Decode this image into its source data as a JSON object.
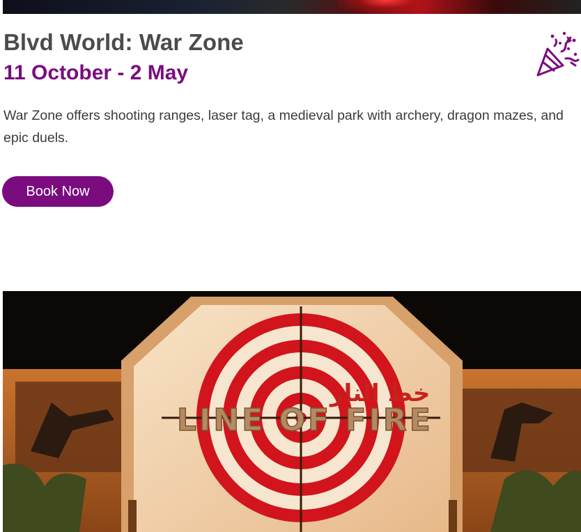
{
  "event": {
    "title": "Blvd World: War Zone",
    "dates": "11 October - 2 May",
    "description": "War Zone offers shooting ranges, laser tag, a medieval park with archery, dragon mazes, and epic duels.",
    "book_label": "Book Now"
  },
  "photo": {
    "sign_text": "LINE OF FIRE",
    "arabic_text": "خط النار"
  },
  "icons": {
    "celebration": "party-popper-icon"
  },
  "colors": {
    "brand_purple": "#7a0c7f",
    "title_gray": "#4b4b4b",
    "body_text": "#3b3b3b"
  }
}
